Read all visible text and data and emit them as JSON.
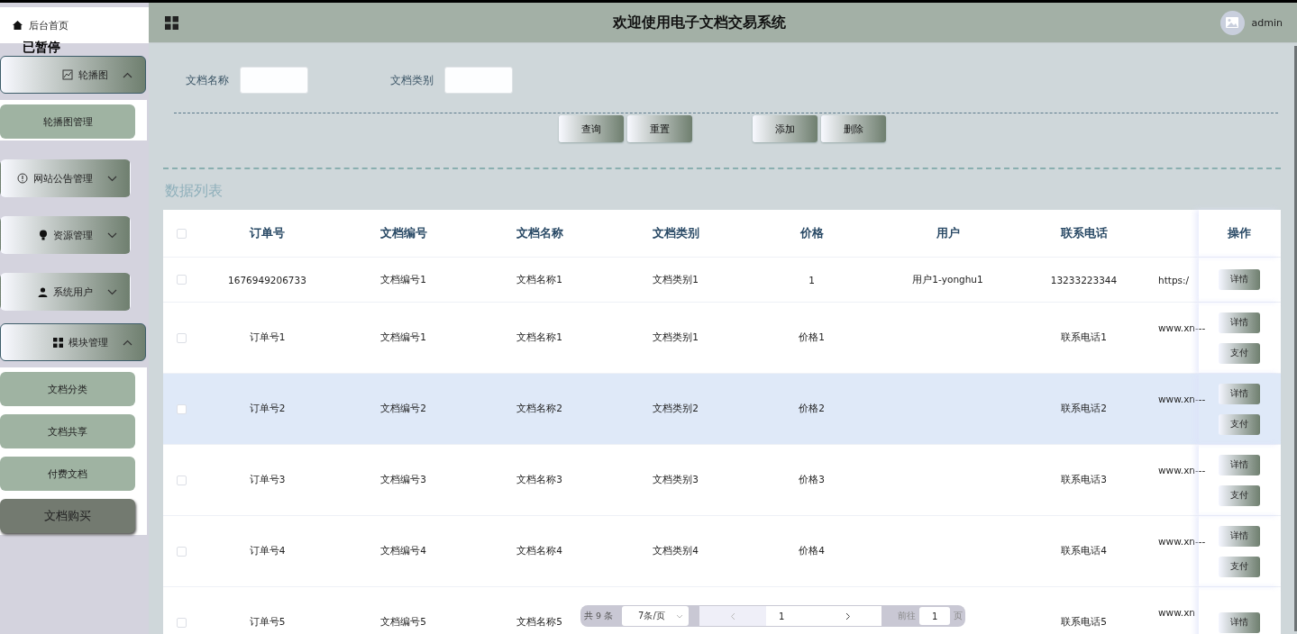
{
  "sidebar": {
    "home": "后台首页",
    "paused_label": "已暂停",
    "groups": [
      {
        "label": "轮播图",
        "kind": "image",
        "expanded": true,
        "children": [
          {
            "label": "轮播图管理",
            "selected": false
          }
        ]
      },
      {
        "label": "网站公告管理",
        "kind": "info",
        "expanded": false
      },
      {
        "label": "资源管理",
        "kind": "bulb",
        "expanded": false
      },
      {
        "label": "系统用户",
        "kind": "user",
        "expanded": false
      },
      {
        "label": "模块管理",
        "kind": "grid",
        "expanded": true,
        "children": [
          {
            "label": "文档分类",
            "selected": false
          },
          {
            "label": "文档共享",
            "selected": false
          },
          {
            "label": "付费文档",
            "selected": false
          },
          {
            "label": "文档购买",
            "selected": true
          }
        ]
      }
    ]
  },
  "header": {
    "title": "欢迎使用电子文档交易系统",
    "user": "admin"
  },
  "search": {
    "fields": [
      {
        "label": "文档名称"
      },
      {
        "label": "文档类别"
      }
    ],
    "buttons": [
      "查询",
      "重置"
    ],
    "actions": [
      "添加",
      "删除"
    ]
  },
  "section_title": "数据列表",
  "table": {
    "header_checked": false,
    "columns": [
      "订单号",
      "文档编号",
      "文档名称",
      "文档类别",
      "价格",
      "用户",
      "联系电话"
    ],
    "action_column": "操作",
    "rows": [
      {
        "checked": false,
        "highlighted": false,
        "cells": [
          "1676949206733",
          "文档编号1",
          "文档名称1",
          "文档类别1",
          "1",
          "用户1-yonghu1",
          "13233223344"
        ],
        "column_8": "https:/",
        "column_8_top": false,
        "actions": [
          "详情"
        ]
      },
      {
        "checked": false,
        "highlighted": false,
        "cells": [
          "订单号1",
          "文档编号1",
          "文档名称1",
          "文档类别1",
          "价格1",
          null,
          "联系电话1"
        ],
        "column_8": "www.xn---",
        "column_8_top": true,
        "actions": [
          "详情",
          "支付"
        ]
      },
      {
        "checked": false,
        "highlighted": true,
        "cells": [
          "订单号2",
          "文档编号2",
          "文档名称2",
          "文档类别2",
          "价格2",
          null,
          "联系电话2"
        ],
        "column_8": "www.xn---",
        "column_8_top": true,
        "actions": [
          "详情",
          "支付"
        ]
      },
      {
        "checked": false,
        "highlighted": false,
        "cells": [
          "订单号3",
          "文档编号3",
          "文档名称3",
          "文档类别3",
          "价格3",
          null,
          "联系电话3"
        ],
        "column_8": "www.xn---",
        "column_8_top": true,
        "actions": [
          "详情",
          "支付"
        ]
      },
      {
        "checked": false,
        "highlighted": false,
        "cells": [
          "订单号4",
          "文档编号4",
          "文档名称4",
          "文档类别4",
          "价格4",
          null,
          "联系电话4"
        ],
        "column_8": "www.xn---",
        "column_8_top": true,
        "actions": [
          "详情",
          "支付"
        ]
      },
      {
        "checked": false,
        "highlighted": false,
        "cells": [
          "订单号5",
          "文档编号5",
          "文档名称5",
          null,
          null,
          null,
          "联系电话5"
        ],
        "column_8": "www.xn",
        "column_8_top": true,
        "actions": [
          "详情"
        ]
      }
    ]
  },
  "pagination": {
    "total": "共 9 条",
    "page_size": "7条/页",
    "current_page": "1",
    "goto_label": "前往",
    "goto_value": "1",
    "goto_suffix": "页"
  }
}
